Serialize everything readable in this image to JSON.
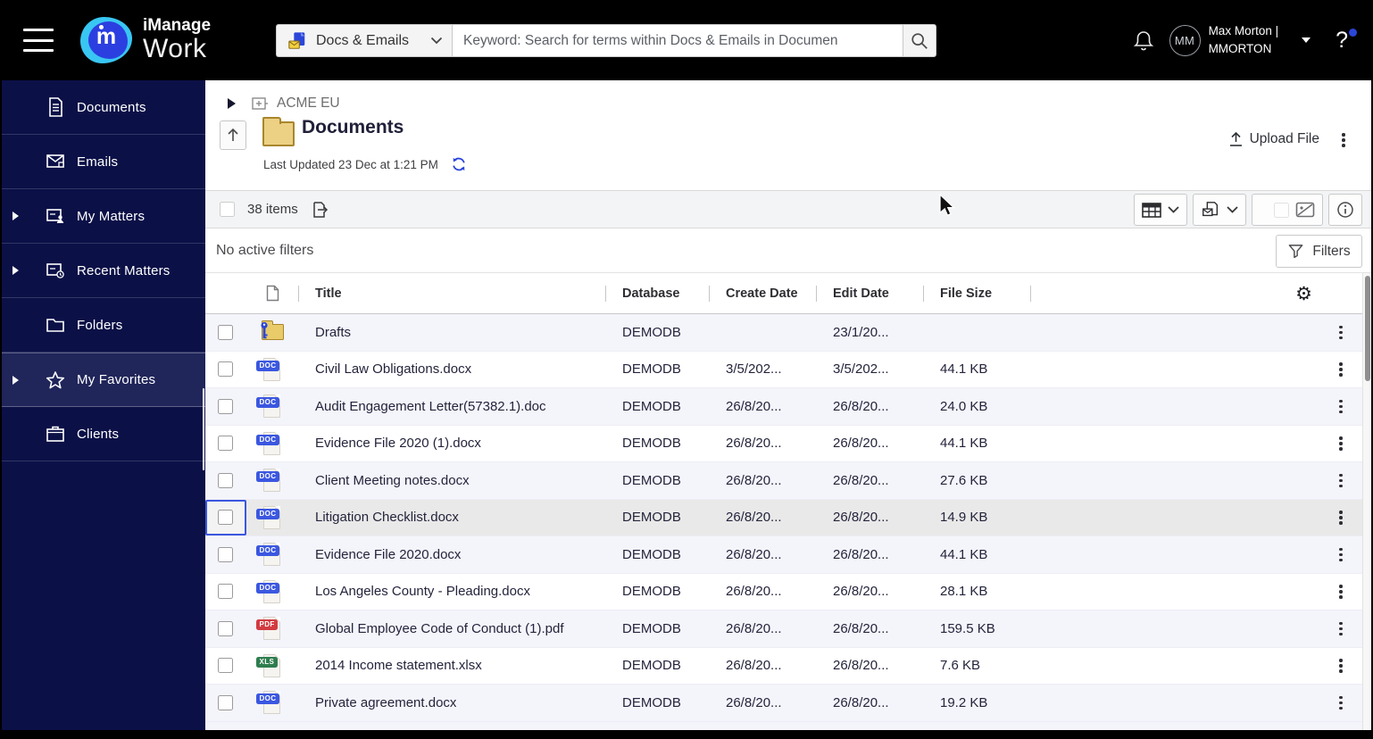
{
  "header": {
    "brand_line1": "iManage",
    "brand_line2": "Work",
    "logo_letter": "m",
    "scope_selector": {
      "label": "Docs & Emails"
    },
    "search": {
      "placeholder": "Keyword: Search for terms within Docs & Emails in Documen"
    },
    "user": {
      "initials": "MM",
      "name": "Max Morton |",
      "id": "MMORTON"
    },
    "help_label": "?"
  },
  "sidebar": {
    "items": [
      {
        "label": "Documents",
        "icon": "documents-icon",
        "expandable": false,
        "selected": false
      },
      {
        "label": "Emails",
        "icon": "emails-icon",
        "expandable": false,
        "selected": false
      },
      {
        "label": "My Matters",
        "icon": "my-matters-icon",
        "expandable": true,
        "selected": false
      },
      {
        "label": "Recent Matters",
        "icon": "recent-matters-icon",
        "expandable": true,
        "selected": false
      },
      {
        "label": "Folders",
        "icon": "folders-icon",
        "expandable": false,
        "selected": false
      },
      {
        "label": "My Favorites",
        "icon": "favorites-star-icon",
        "expandable": true,
        "selected": true
      },
      {
        "label": "Clients",
        "icon": "clients-icon",
        "expandable": false,
        "selected": false
      }
    ]
  },
  "page": {
    "breadcrumb_workspace": "ACME EU",
    "title": "Documents",
    "last_updated": "Last Updated 23 Dec at 1:21 PM",
    "upload_button": "Upload File",
    "items_count": "38 items",
    "filter_status": "No active filters",
    "filters_button": "Filters"
  },
  "table": {
    "columns": {
      "title": "Title",
      "database": "Database",
      "create_date": "Create Date",
      "edit_date": "Edit Date",
      "file_size": "File Size"
    },
    "rows": [
      {
        "icon": "folder-key-icon",
        "icon_class": "is-folder",
        "badge": "",
        "badge_class": "",
        "title": "Drafts",
        "database": "DEMODB",
        "create_date": "",
        "edit_date": "23/1/20...",
        "file_size": ""
      },
      {
        "icon": "word-doc-icon",
        "badge": "DOC",
        "badge_class": "b-doc",
        "title": "Civil Law Obligations.docx",
        "database": "DEMODB",
        "create_date": "3/5/202...",
        "edit_date": "3/5/202...",
        "file_size": "44.1 KB"
      },
      {
        "icon": "word-doc-icon",
        "badge": "DOC",
        "badge_class": "b-doc",
        "title": "Audit Engagement Letter(57382.1).doc",
        "database": "DEMODB",
        "create_date": "26/8/20...",
        "edit_date": "26/8/20...",
        "file_size": "24.0 KB"
      },
      {
        "icon": "word-doc-icon",
        "badge": "DOC",
        "badge_class": "b-doc",
        "title": "Evidence File 2020 (1).docx",
        "database": "DEMODB",
        "create_date": "26/8/20...",
        "edit_date": "26/8/20...",
        "file_size": "44.1 KB"
      },
      {
        "icon": "word-doc-icon",
        "badge": "DOC",
        "badge_class": "b-doc",
        "title": "Client Meeting notes.docx",
        "database": "DEMODB",
        "create_date": "26/8/20...",
        "edit_date": "26/8/20...",
        "file_size": "27.6 KB"
      },
      {
        "icon": "word-doc-icon",
        "badge": "DOC",
        "badge_class": "b-doc",
        "state": "hovered",
        "title": "Litigation Checklist.docx",
        "database": "DEMODB",
        "create_date": "26/8/20...",
        "edit_date": "26/8/20...",
        "file_size": "14.9 KB"
      },
      {
        "icon": "word-doc-icon",
        "badge": "DOC",
        "badge_class": "b-doc",
        "title": "Evidence File 2020.docx",
        "database": "DEMODB",
        "create_date": "26/8/20...",
        "edit_date": "26/8/20...",
        "file_size": "44.1 KB"
      },
      {
        "icon": "word-doc-icon",
        "badge": "DOC",
        "badge_class": "b-doc",
        "title": "Los Angeles County - Pleading.docx",
        "database": "DEMODB",
        "create_date": "26/8/20...",
        "edit_date": "26/8/20...",
        "file_size": "28.1 KB"
      },
      {
        "icon": "pdf-doc-icon",
        "badge": "PDF",
        "badge_class": "b-pdf",
        "title": "Global Employee Code of Conduct (1).pdf",
        "database": "DEMODB",
        "create_date": "26/8/20...",
        "edit_date": "26/8/20...",
        "file_size": "159.5 KB"
      },
      {
        "icon": "excel-doc-icon",
        "badge": "XLS",
        "badge_class": "b-xls",
        "title": "2014 Income statement.xlsx",
        "database": "DEMODB",
        "create_date": "26/8/20...",
        "edit_date": "26/8/20...",
        "file_size": "7.6 KB"
      },
      {
        "icon": "word-doc-icon",
        "badge": "DOC",
        "badge_class": "b-doc",
        "title": "Private agreement.docx",
        "database": "DEMODB",
        "create_date": "26/8/20...",
        "edit_date": "26/8/20...",
        "file_size": "19.2 KB"
      }
    ]
  },
  "colors": {
    "accent_blue": "#2b46d9",
    "sidebar_navy": "#0b1047",
    "doc_badge": "#3b57e0",
    "pdf_badge": "#d23b41",
    "xls_badge": "#2e7d4f",
    "row_alt": "#f4f4fb",
    "row_hover": "#e9e9e9",
    "folder_yellow": "#e9cb6a"
  }
}
